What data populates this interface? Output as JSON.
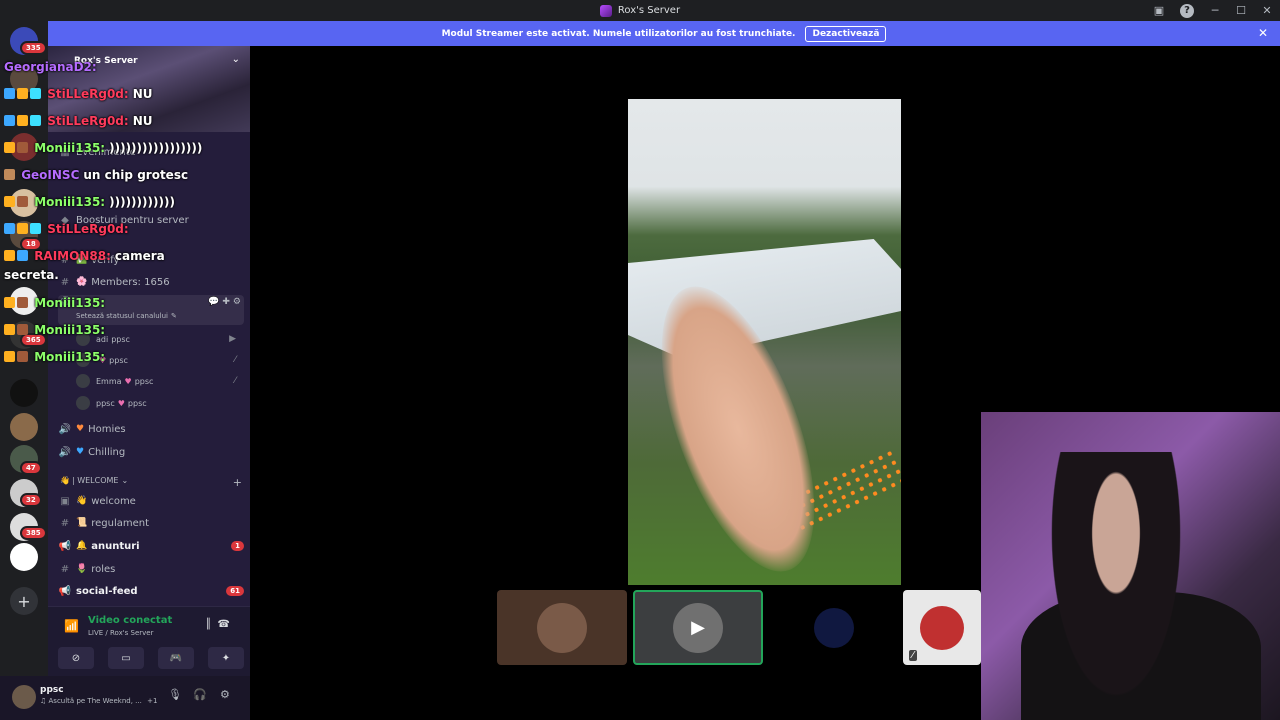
{
  "window": {
    "title": "Rox's Server"
  },
  "banner": {
    "text": "Modul Streamer este activat. Numele utilizatorilor au fost trunchiate.",
    "button": "Dezactivează"
  },
  "rail": {
    "badges": [
      "335",
      "18",
      "365",
      "47",
      "32",
      "385"
    ]
  },
  "server": {
    "name": "Rox's Server"
  },
  "channels": {
    "events": "Evenimente",
    "boosts": "Boosturi pentru server",
    "verify": "verify",
    "members": "Members: 1656",
    "status_hint": "Setează statusul canalului",
    "homies": "Homies",
    "chilling": "Chilling",
    "category": "| WELCOME",
    "welcome": "welcome",
    "regulament": "regulament",
    "anunturi": "anunturi",
    "anunturi_count": "1",
    "roles": "roles",
    "social_feed": "social-feed",
    "social_feed_count": "61"
  },
  "voice_users": [
    {
      "name": "adi",
      "tag": "ppsc"
    },
    {
      "name": "",
      "tag": "ppsc"
    },
    {
      "name": "Emma",
      "tag": "ppsc"
    },
    {
      "name": "ppsc",
      "tag": "ppsc"
    }
  ],
  "voice": {
    "title": "Video conectat",
    "subtitle": "LIVE / Rox's Server"
  },
  "user": {
    "name": "ppsc",
    "status": "Ascultă pe The Weeknd, ...",
    "extra": "+1"
  },
  "chat": [
    {
      "user": "GeorgianaD2:",
      "text": "",
      "color": "#b56cff"
    },
    {
      "user": "StiLLeRg0d:",
      "text": "NU",
      "color": "#ff3b5c"
    },
    {
      "user": "StiLLeRg0d:",
      "text": "NU",
      "color": "#ff3b5c"
    },
    {
      "user": "Moniii135:",
      "text": ")))))))))))))))))",
      "color": "#8cff6a"
    },
    {
      "user": "GeoINSC",
      "text": "un chip grotesc",
      "color": "#b56cff"
    },
    {
      "user": "Moniii135:",
      "text": "))))))))))))",
      "color": "#8cff6a"
    },
    {
      "user": "StiLLeRg0d:",
      "text": "",
      "color": "#ff3b5c"
    },
    {
      "user": "RAIMON88:",
      "text": "camera",
      "color": "#ff3b5c"
    },
    {
      "user": "",
      "text": "secreta.",
      "color": "#ffffff"
    },
    {
      "user": "Moniii135:",
      "text": "",
      "color": "#8cff6a"
    },
    {
      "user": "Moniii135:",
      "text": "",
      "color": "#8cff6a"
    },
    {
      "user": "Moniii135:",
      "text": "",
      "color": "#8cff6a"
    }
  ],
  "colors": {
    "accent": "#5865f2",
    "online": "#23a55a",
    "mention": "#da373c"
  }
}
